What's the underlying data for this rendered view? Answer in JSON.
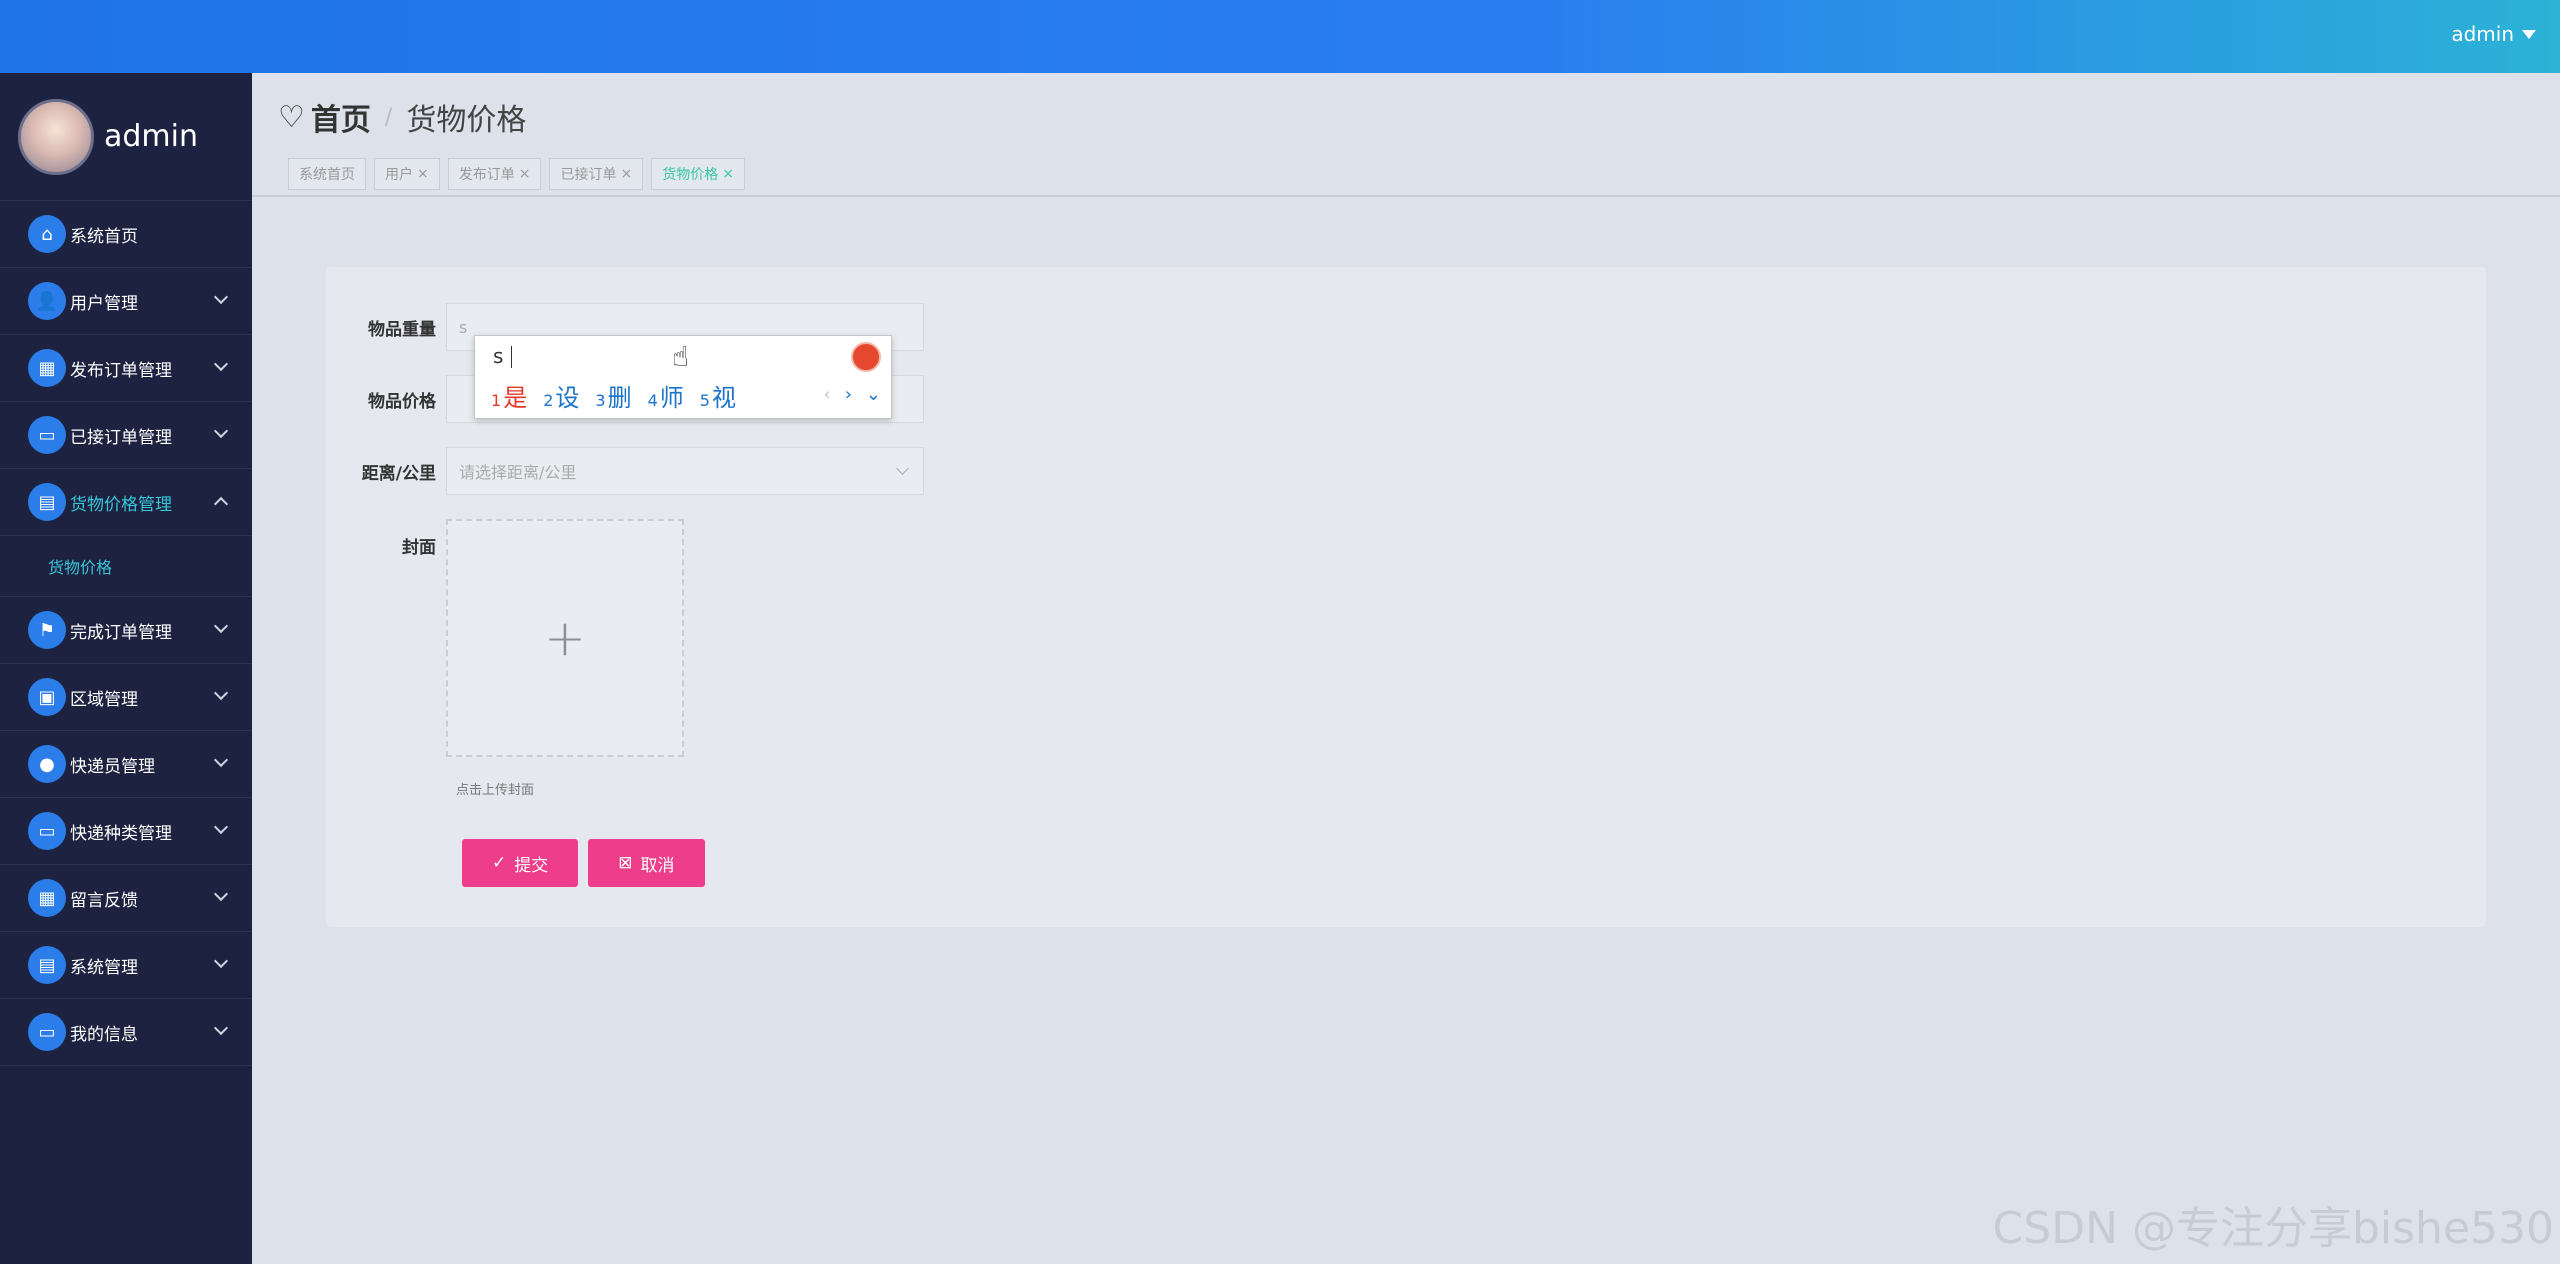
{
  "topbar": {
    "user": "admin"
  },
  "sidebar": {
    "profile_name": "admin",
    "items": [
      {
        "label": "系统首页",
        "icon": "home-icon",
        "glyph": "⌂",
        "expandable": false
      },
      {
        "label": "用户管理",
        "icon": "user-icon",
        "glyph": "👤",
        "expandable": true
      },
      {
        "label": "发布订单管理",
        "icon": "grid-icon",
        "glyph": "▦",
        "expandable": true
      },
      {
        "label": "已接订单管理",
        "icon": "monitor-icon",
        "glyph": "▭",
        "expandable": true
      },
      {
        "label": "货物价格管理",
        "icon": "chart-icon",
        "glyph": "▤",
        "expandable": true,
        "active": true
      },
      {
        "label": "完成订单管理",
        "icon": "flag-icon",
        "glyph": "⚑",
        "expandable": true
      },
      {
        "label": "区域管理",
        "icon": "message-icon",
        "glyph": "▣",
        "expandable": true
      },
      {
        "label": "快递员管理",
        "icon": "bulb-icon",
        "glyph": "●",
        "expandable": true
      },
      {
        "label": "快递种类管理",
        "icon": "laptop-icon",
        "glyph": "▭",
        "expandable": true
      },
      {
        "label": "留言反馈",
        "icon": "grid2-icon",
        "glyph": "▦",
        "expandable": true
      },
      {
        "label": "系统管理",
        "icon": "clipboard-icon",
        "glyph": "▤",
        "expandable": true
      },
      {
        "label": "我的信息",
        "icon": "card-icon",
        "glyph": "▭",
        "expandable": true
      }
    ],
    "submenu": {
      "label": "货物价格"
    }
  },
  "header": {
    "home": "首页",
    "sep": "/",
    "current": "货物价格",
    "tabs": [
      {
        "label": "系统首页",
        "closable": false
      },
      {
        "label": "用户",
        "closable": true
      },
      {
        "label": "发布订单",
        "closable": true
      },
      {
        "label": "已接订单",
        "closable": true
      },
      {
        "label": "货物价格",
        "closable": true,
        "active": true
      }
    ]
  },
  "form": {
    "weight_label": "物品重量",
    "weight_value": "s",
    "price_label": "物品价格",
    "price_value": "",
    "distance_label": "距离/公里",
    "distance_placeholder": "请选择距离/公里",
    "cover_label": "封面",
    "upload_tip": "点击上传封面",
    "submit_label": "提交",
    "cancel_label": "取消"
  },
  "ime": {
    "composition": "s",
    "candidates": [
      {
        "num": "1",
        "text": "是"
      },
      {
        "num": "2",
        "text": "设"
      },
      {
        "num": "3",
        "text": "删"
      },
      {
        "num": "4",
        "text": "师"
      },
      {
        "num": "5",
        "text": "视"
      }
    ]
  },
  "watermark": "CSDN @专注分享bishe530",
  "colors": {
    "accent": "#2b7de9",
    "active_text": "#38c6d6",
    "button": "#ee3d8a"
  }
}
